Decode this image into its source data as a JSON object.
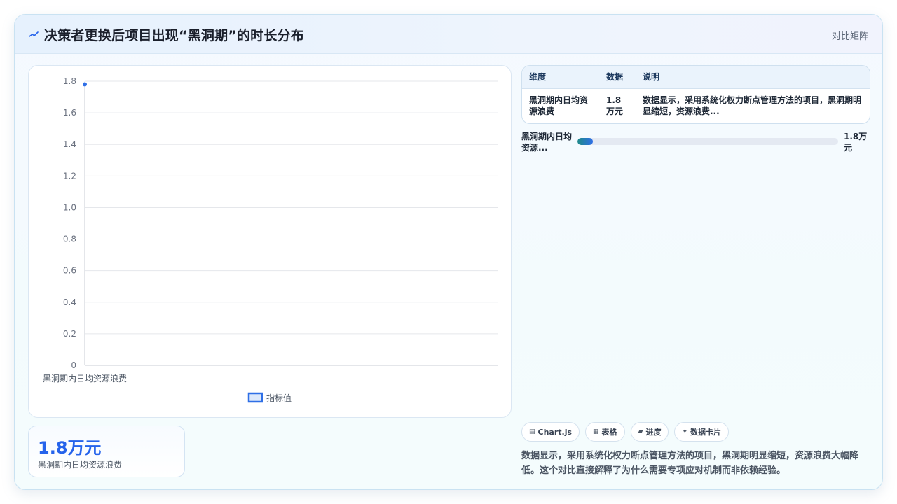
{
  "header": {
    "icon": "trend-icon",
    "title": "决策者更换后项目出现“黑洞期”的时长分布",
    "right_label": "对比矩阵"
  },
  "colors": {
    "accent": "#2563eb",
    "series_fill": "#dce8fb",
    "series_stroke": "#2f6fe6",
    "grid": "#e5e7eb",
    "progress_start": "#1f8a8a",
    "progress_end": "#2f6fe6"
  },
  "chart_data": {
    "type": "line",
    "categories": [
      "黑洞期内日均资源浪费"
    ],
    "series": [
      {
        "name": "指标值",
        "values": [
          1.78
        ]
      }
    ],
    "ylim": [
      0,
      1.8
    ],
    "yticks": [
      "1.8",
      "1.6",
      "1.4",
      "1.2",
      "1.0",
      "0.8",
      "0.6",
      "0.4",
      "0.2",
      "0"
    ],
    "grid": true,
    "legend": "bottom"
  },
  "kpi": {
    "value": "1.8万元",
    "label": "黑洞期内日均资源浪费"
  },
  "table": {
    "headers": [
      "维度",
      "数据",
      "说明"
    ],
    "rows": [
      [
        "黑洞期内日均资源浪费",
        "1.8万元",
        "数据显示，采用系统化权力断点管理方法的项目，黑洞期明显缩短，资源浪费..."
      ]
    ]
  },
  "progress": {
    "label": "黑洞期内日均资源...",
    "value_text": "1.8万元",
    "fraction": 0.06
  },
  "tags": [
    {
      "icon": "chart-icon",
      "glyph": "▤",
      "label": "Chart.js"
    },
    {
      "icon": "table-icon",
      "glyph": "▦",
      "label": "表格"
    },
    {
      "icon": "progress-icon",
      "glyph": "▰",
      "label": "进度"
    },
    {
      "icon": "card-icon",
      "glyph": "✦",
      "label": "数据卡片"
    }
  ],
  "description": "数据显示，采用系统化权力断点管理方法的项目，黑洞期明显缩短，资源浪费大幅降低。这个对比直接解释了为什么需要专项应对机制而非依赖经验。"
}
